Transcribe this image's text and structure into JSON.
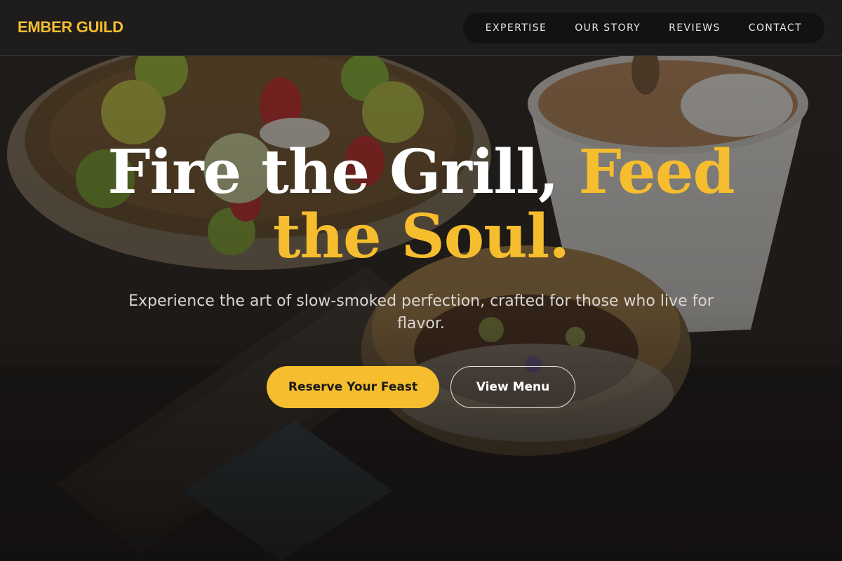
{
  "brand": {
    "name": "EMBER GUILD"
  },
  "nav": {
    "items": [
      {
        "label": "EXPERTISE"
      },
      {
        "label": "OUR STORY"
      },
      {
        "label": "REVIEWS"
      },
      {
        "label": "CONTACT"
      }
    ]
  },
  "hero": {
    "headline_part1": "Fire the Grill, ",
    "headline_accent": "Feed the Soul.",
    "subtitle": "Experience the art of slow-smoked perfection, crafted for those who live for flavor.",
    "primary_cta": "Reserve Your Feast",
    "secondary_cta": "View Menu",
    "background_alt": "barbecue"
  },
  "colors": {
    "accent": "#f6bd2e",
    "header_bg": "#1e1d1c",
    "nav_pill_bg": "#121212",
    "page_bg": "#1a1816"
  }
}
